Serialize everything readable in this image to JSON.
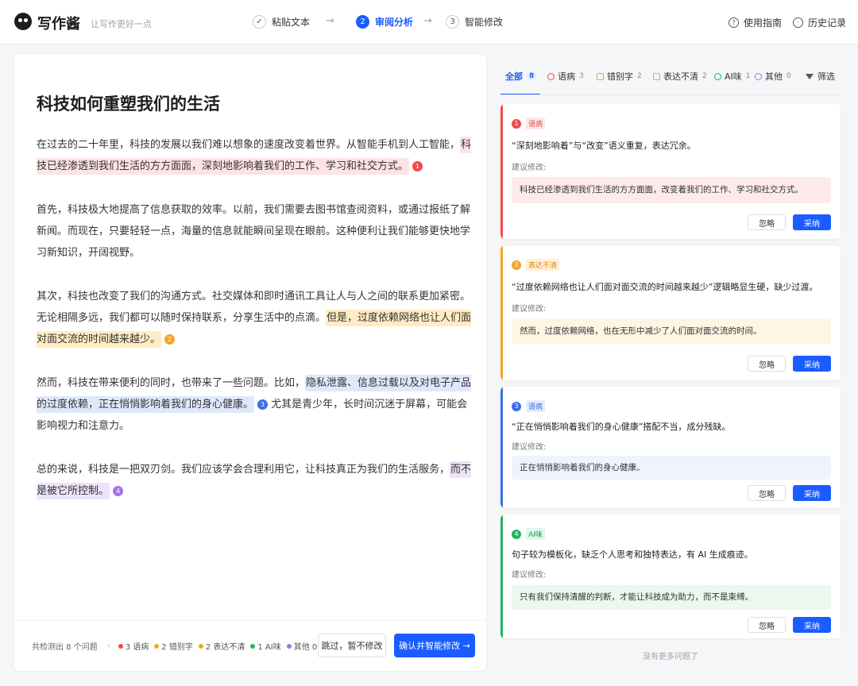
{
  "header": {
    "brand": "写作酱",
    "slogan": "让写作更好一点",
    "steps": [
      {
        "num": "✓",
        "label": "粘贴文本"
      },
      {
        "num": "2",
        "label": "审阅分析"
      },
      {
        "num": "3",
        "label": "智能修改"
      }
    ],
    "arrow": "→",
    "guide": "使用指南",
    "history": "历史记录"
  },
  "editor": {
    "title": "科技如何重塑我们的生活",
    "p1a": "在过去的二十年里，科技的发展以我们难以想象的速度改变着世界。从智能手机到人工智能，",
    "p1h": "科技已经渗透到我们生活的方方面面，深刻地影响着我们的工作、学习和社交方式。",
    "p1m": "1",
    "p2": "首先，科技极大地提高了信息获取的效率。以前，我们需要去图书馆查阅资料，或通过报纸了解新闻。而现在，只要轻轻一点，海量的信息就能瞬间呈现在眼前。这种便利让我们能够更快地学习新知识，开阔视野。",
    "p3a": "其次，科技也改变了我们的沟通方式。社交媒体和即时通讯工具让人与人之间的联系更加紧密。无论相隔多远，我们都可以随时保持联系，分享生活中的点滴。",
    "p3h": "但是，过度依赖网络也让人们面对面交流的时间越来越少。",
    "p3m": "2",
    "p4a": "然而，科技在带来便利的同时，也带来了一些问题。比如，",
    "p4h": "隐私泄露、信息过载以及对电子产品的过度依赖，正在悄悄影响着我们的身心健康。",
    "p4m": "3",
    "p4b": "尤其是青少年，长时间沉迷于屏幕，可能会影响视力和注意力。",
    "p5a": "总的来说，科技是一把双刃剑。我们应该学会合理利用它，让科技真正为我们的生活服务，",
    "p5h": "而不是被它所控制。",
    "p5m": "4"
  },
  "footer": {
    "summary": "共检测出 8 个问题",
    "chevron": "›",
    "counts": [
      {
        "text": "3 语病",
        "color": "#f04b4b"
      },
      {
        "text": "2 错别字",
        "color": "#f5a524"
      },
      {
        "text": "2 表达不清",
        "color": "#f5a524"
      },
      {
        "text": "1 AI味",
        "color": "#22b35e"
      },
      {
        "text": "其他 0",
        "color": "#a374e8"
      }
    ],
    "skip": "跳过，暂不修改",
    "confirm": "确认并智能修改 →"
  },
  "tabs": [
    {
      "label": "全部",
      "count": "8",
      "color": ""
    },
    {
      "label": "语病",
      "count": "3",
      "color": "#f04b4b"
    },
    {
      "label": "错别字",
      "count": "2",
      "color": "#f5a524"
    },
    {
      "label": "表达不清",
      "count": "2",
      "color": "#f5a524"
    },
    {
      "label": "AI味",
      "count": "1",
      "color": "#22b35e"
    },
    {
      "label": "其他",
      "count": "0",
      "color": "#a374e8"
    }
  ],
  "filter": "筛选",
  "cards": [
    {
      "num": "1",
      "tag": "语病",
      "color": "#f04b4b",
      "tagbg": "#fde7e7",
      "sugbg": "#fdeaea",
      "desc": "“深刻地影响着”与“改变”语义重复，表达冗余。",
      "label": "建议修改:",
      "suggestion": "科技已经渗透到我们生活的方方面面，改变着我们的工作、学习和社交方式。",
      "ignore": "忽略",
      "accept": "采纳"
    },
    {
      "num": "2",
      "tag": "表达不清",
      "color": "#f5a524",
      "tagbg": "#fff0d6",
      "sugbg": "#fff5e3",
      "desc": "“过度依赖网络也让人们面对面交流的时间越来越少”逻辑略显生硬，缺少过渡。",
      "label": "建议修改:",
      "suggestion": "然而，过度依赖网络，也在无形中减少了人们面对面交流的时间。",
      "ignore": "忽略",
      "accept": "采纳"
    },
    {
      "num": "3",
      "tag": "语病",
      "color": "#3b6ee8",
      "tagbg": "#e4ecfd",
      "sugbg": "#eef3fd",
      "desc": "“正在悄悄影响着我们的身心健康”搭配不当，成分残缺。",
      "label": "建议修改:",
      "suggestion": "正在悄悄影响着我们的身心健康。",
      "ignore": "忽略",
      "accept": "采纳"
    },
    {
      "num": "4",
      "tag": "AI味",
      "color": "#22b35e",
      "tagbg": "#e2f6ea",
      "sugbg": "#eaf8ef",
      "desc": "句子较为模板化，缺乏个人思考和独特表达，有 AI 生成痕迹。",
      "label": "建议修改:",
      "suggestion": "只有我们保持清醒的判断，才能让科技成为助力，而不是束缚。",
      "ignore": "忽略",
      "accept": "采纳"
    }
  ],
  "no_more": "没有更多问题了"
}
